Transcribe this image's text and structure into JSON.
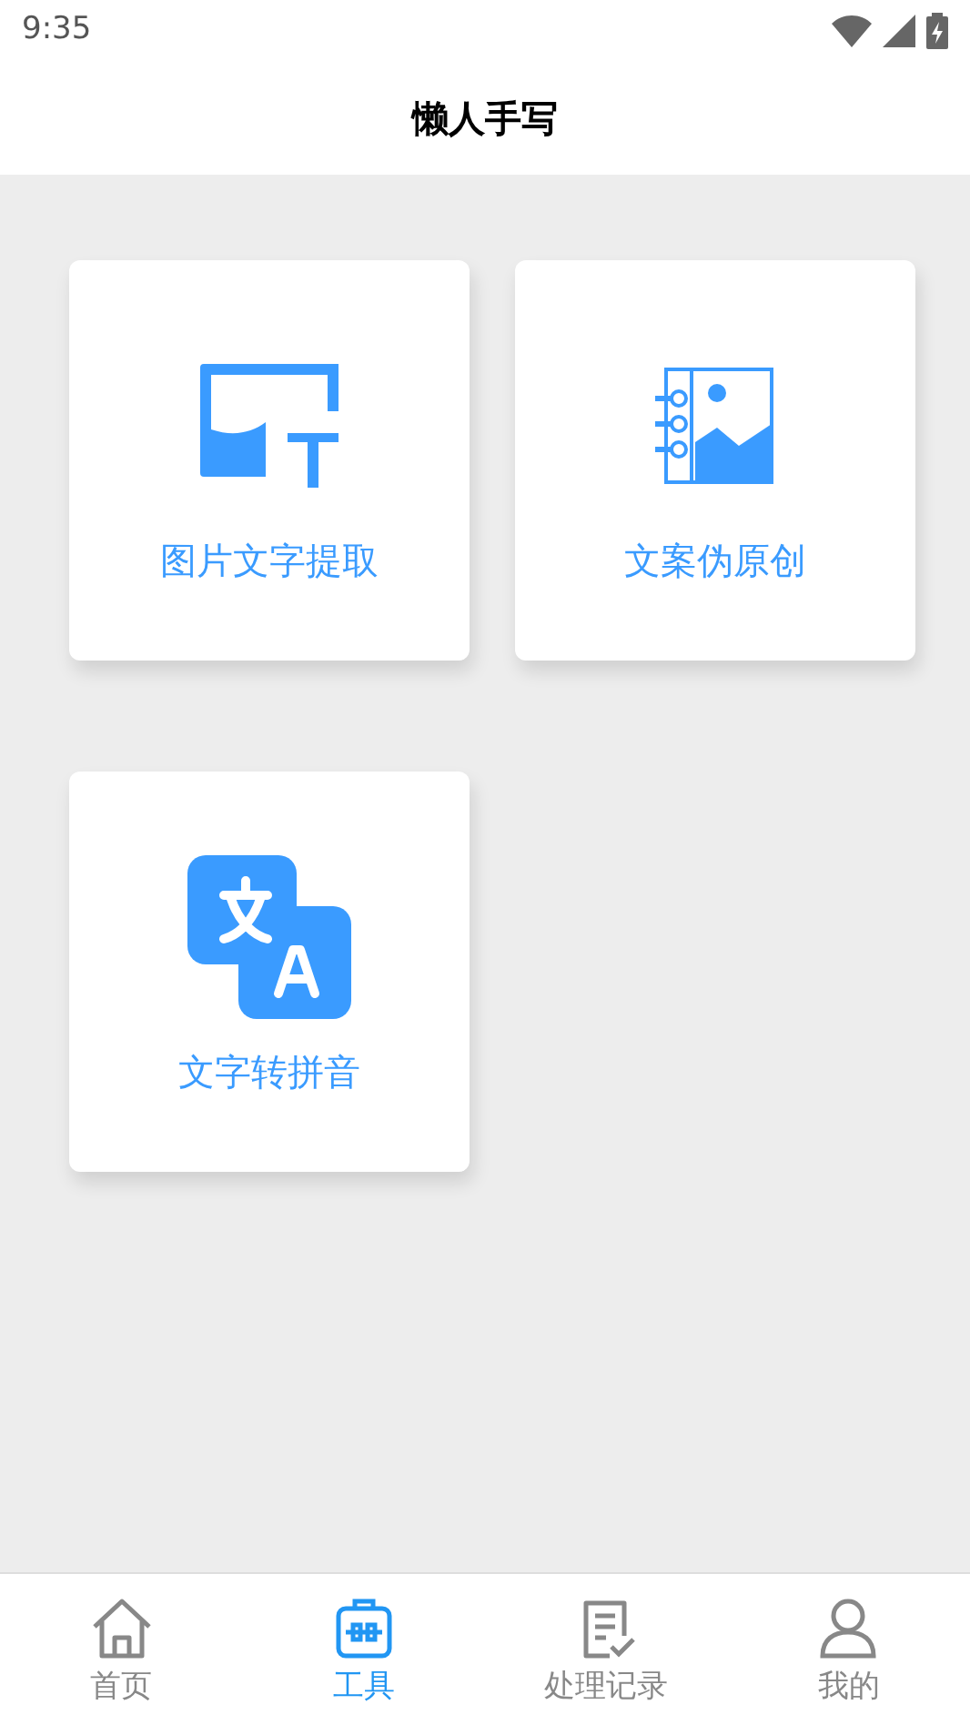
{
  "status_bar": {
    "time": "9:35"
  },
  "header": {
    "title": "懒人手写"
  },
  "tools": [
    {
      "kind": "image-text",
      "label": "图片文字提取"
    },
    {
      "kind": "notebook",
      "label": "文案伪原创"
    },
    {
      "kind": "translate",
      "label": "文字转拼音"
    }
  ],
  "bottom_nav": [
    {
      "kind": "home",
      "label": "首页",
      "selected": false
    },
    {
      "kind": "toolbox",
      "label": "工具",
      "selected": true
    },
    {
      "kind": "records",
      "label": "处理记录",
      "selected": false
    },
    {
      "kind": "profile",
      "label": "我的",
      "selected": false
    }
  ]
}
